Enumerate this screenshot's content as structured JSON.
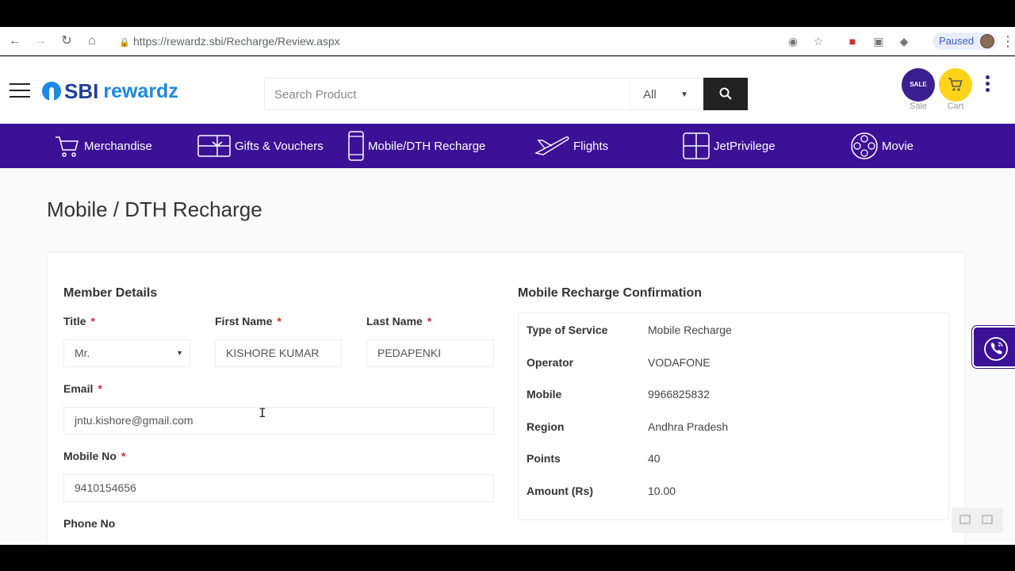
{
  "browser": {
    "url": "https://rewardz.sbi/Recharge/Review.aspx",
    "profile_status": "Paused"
  },
  "header": {
    "logo_main": "SBI",
    "logo_sub": "rewardz",
    "search_placeholder": "Search Product",
    "category_selected": "All",
    "sale_label": "Sale",
    "cart_label": "Cart",
    "sale_badge": "SALE"
  },
  "nav": [
    {
      "label": "Merchandise",
      "icon": "cart-icon"
    },
    {
      "label": "Gifts & Vouchers",
      "icon": "gift-card-icon"
    },
    {
      "label": "Mobile/DTH Recharge",
      "icon": "mobile-icon"
    },
    {
      "label": "Flights",
      "icon": "plane-icon"
    },
    {
      "label": "JetPrivilege",
      "icon": "grid-icon"
    },
    {
      "label": "Movie",
      "icon": "film-reel-icon"
    }
  ],
  "page": {
    "title": "Mobile / DTH Recharge"
  },
  "member": {
    "section_title": "Member Details",
    "title_label": "Title",
    "title_value": "Mr.",
    "first_name_label": "First Name",
    "first_name_value": "KISHORE KUMAR",
    "last_name_label": "Last Name",
    "last_name_value": "PEDAPENKI",
    "email_label": "Email",
    "email_value": "jntu.kishore@gmail.com",
    "mobile_label": "Mobile No",
    "mobile_value": "9410154656",
    "phone_label": "Phone No",
    "required_mark": "*"
  },
  "confirmation": {
    "section_title": "Mobile Recharge Confirmation",
    "rows": [
      {
        "key": "Type of Service",
        "value": "Mobile Recharge"
      },
      {
        "key": "Operator",
        "value": "VODAFONE"
      },
      {
        "key": "Mobile",
        "value": "9966825832"
      },
      {
        "key": "Region",
        "value": "Andhra Pradesh"
      },
      {
        "key": "Points",
        "value": "40"
      },
      {
        "key": "Amount (Rs)",
        "value": "10.00"
      }
    ]
  },
  "colors": {
    "brand_purple": "#3b1196",
    "cart_yellow": "#ffd31a",
    "logo_blue": "#1e88e5"
  }
}
